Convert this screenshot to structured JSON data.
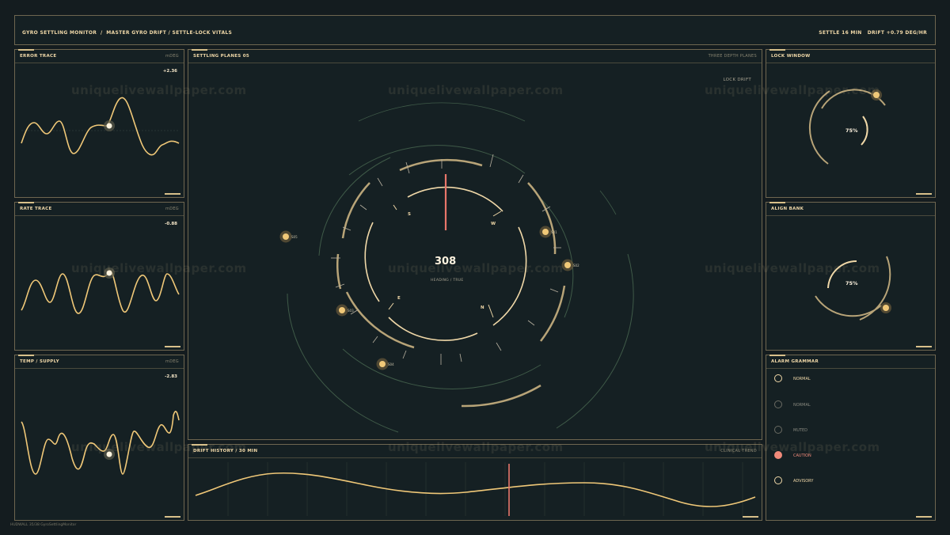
{
  "header": {
    "title": "GYRO SETTLING MONITOR  /  MASTER GYRO DRIFT / SETTLE-LOCK VITALS",
    "status": "SETTLE 16 MIN   DRIFT +0.79 DEG/HR"
  },
  "traces": [
    {
      "title": "ERROR TRACE",
      "unit": "mDEG",
      "value": "+2.36"
    },
    {
      "title": "RATE TRACE",
      "unit": "mDEG",
      "value": "-0.88"
    },
    {
      "title": "TEMP / SUPPLY",
      "unit": "mDEG",
      "value": "-2.83"
    }
  ],
  "planes": {
    "title": "SETTLING PLANES 05",
    "meta": "THREE DEPTH PLANES",
    "status": "LOCK DRIFT",
    "heading_value": "308",
    "heading_label": "HEADING / TRUE",
    "cardinals": {
      "s": "S",
      "w": "W",
      "e": "E",
      "n": "N"
    },
    "markers": [
      "S05",
      "S01",
      "S02",
      "S03",
      "S04"
    ]
  },
  "drift": {
    "title": "DRIFT HISTORY / 30 MIN",
    "meta": "CLINICAL TREND"
  },
  "lock_window": {
    "title": "LOCK WINDOW",
    "value": "75%"
  },
  "align_bank": {
    "title": "ALIGN BANK",
    "value": "75%"
  },
  "alarms": {
    "title": "ALARM GRAMMAR",
    "items": [
      {
        "label": "NORMAL",
        "color": "#f0d8a8"
      },
      {
        "label": "NORMAL",
        "color": "#8a8a80"
      },
      {
        "label": "MUTED",
        "color": "#8a8a80"
      },
      {
        "label": "CAUTION",
        "color": "#f08a7a"
      },
      {
        "label": "ADVISORY",
        "color": "#f0d8a8"
      }
    ]
  },
  "footer": {
    "caption": "HUDWALL 35/38 GyroSettlingMonitor"
  },
  "watermark": "uniquelivewallpaper.com",
  "colors": {
    "accent": "#f0c878",
    "alert": "#e8766a",
    "background": "#141c1f"
  }
}
